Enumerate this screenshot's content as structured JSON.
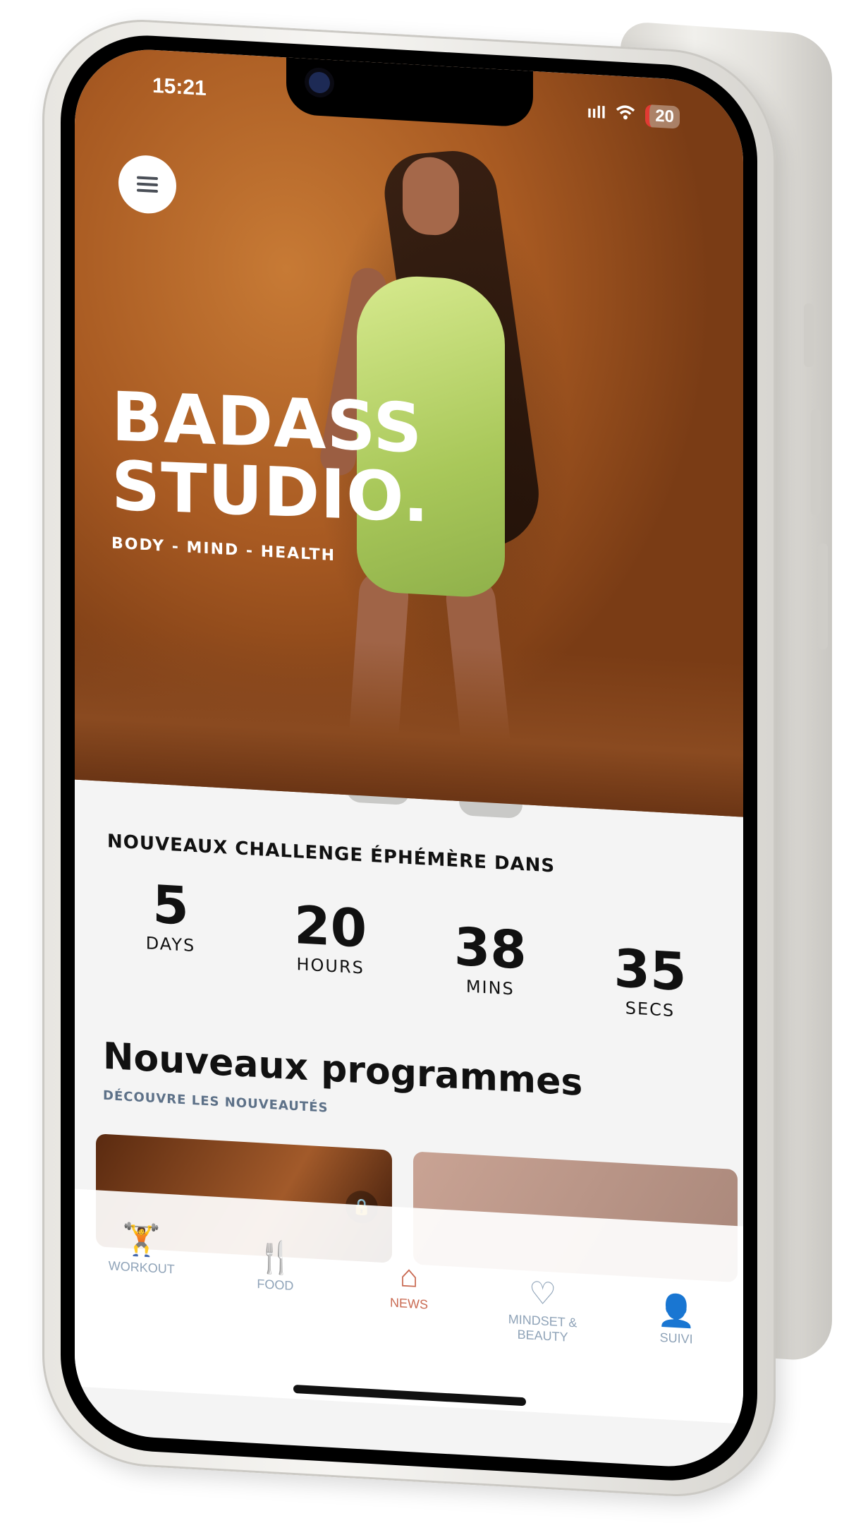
{
  "status_bar": {
    "time": "15:21",
    "signal": "ııll",
    "wifi": "wifi",
    "battery": "20"
  },
  "hero": {
    "title_line1": "BADASS",
    "title_line2": "STUDIO.",
    "subtitle": "BODY - MIND - HEALTH"
  },
  "countdown": {
    "heading": "NOUVEAUX CHALLENGE ÉPHÉMÈRE DANS",
    "units": [
      {
        "value": "5",
        "label": "DAYS"
      },
      {
        "value": "20",
        "label": "HOURS"
      },
      {
        "value": "38",
        "label": "MINS"
      },
      {
        "value": "35",
        "label": "SECS"
      }
    ]
  },
  "programs": {
    "title": "Nouveaux programmes",
    "subtitle": "DÉCOUVRE LES NOUVEAUTÉS"
  },
  "tabbar": {
    "items": [
      {
        "label": "WORKOUT",
        "icon": "dumbbell-icon",
        "glyph": "🏋"
      },
      {
        "label": "FOOD",
        "icon": "fork-knife-icon",
        "glyph": "🍴"
      },
      {
        "label": "NEWS",
        "icon": "home-icon",
        "glyph": "⌂"
      },
      {
        "label": "MINDSET & BEAUTY",
        "icon": "heart-icon",
        "glyph": "♡"
      },
      {
        "label": "SUIVI",
        "icon": "user-icon",
        "glyph": "👤"
      }
    ],
    "active": "NEWS",
    "active_color": "#c96a52",
    "inactive_color": "#8fa3b8"
  },
  "colors": {
    "hero_bg": "#b5652a",
    "outfit": "#c6df79",
    "accent": "#c96a52"
  }
}
